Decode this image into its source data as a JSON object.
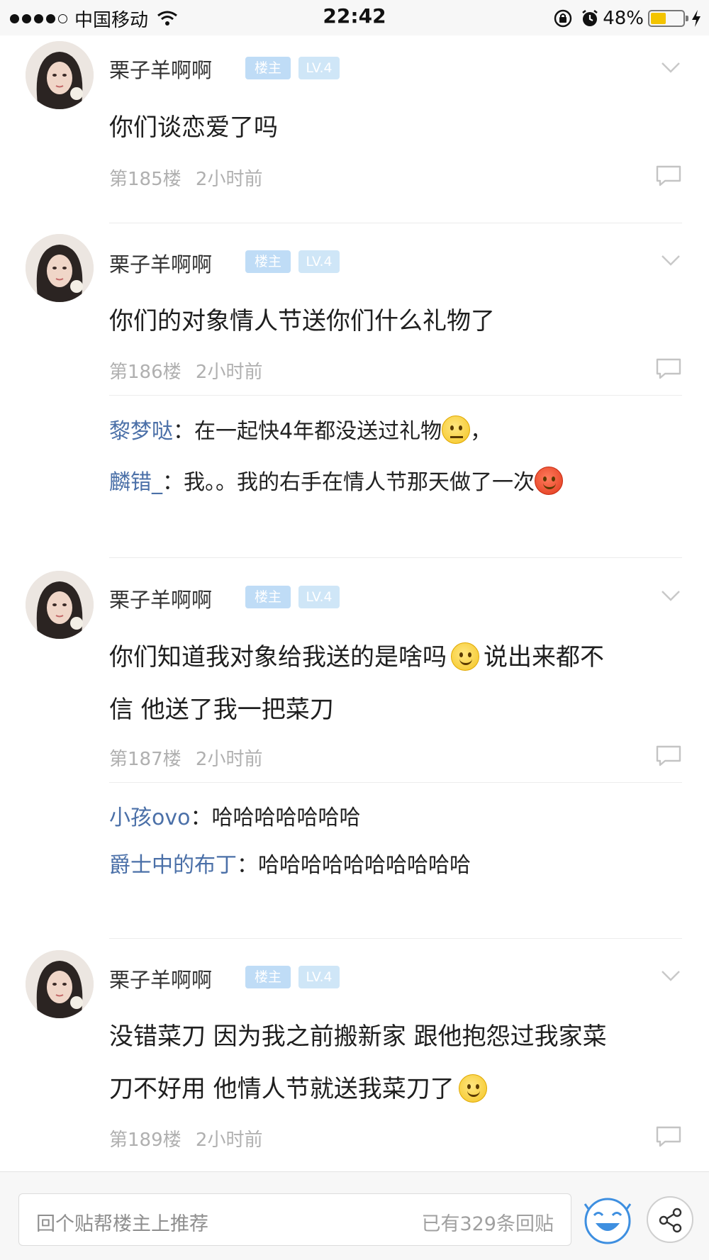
{
  "status_bar": {
    "carrier": "中国移动",
    "time": "22:42",
    "battery_percent": "48%",
    "battery_level": 0.48,
    "battery_color": "#f3c400"
  },
  "posts": [
    {
      "username": "栗子羊啊啊",
      "host_badge": "楼主",
      "level_badge": "LV.4",
      "content_lines": [
        "你们谈恋爱了吗"
      ],
      "floor": "第185楼",
      "time": "2小时前",
      "replies": []
    },
    {
      "username": "栗子羊啊啊",
      "host_badge": "楼主",
      "level_badge": "LV.4",
      "content_lines": [
        "你们的对象情人节送你们什么礼物了"
      ],
      "floor": "第186楼",
      "time": "2小时前",
      "replies": [
        {
          "user": "黎梦哒",
          "text_before": "在一起快4年都没送过礼物",
          "emoji": "sweat-face",
          "text_after": "，"
        },
        {
          "user": "麟错_",
          "text_before": "我。。我的右手在情人节那天做了一次",
          "emoji": "red-grin-face",
          "text_after": ""
        }
      ]
    },
    {
      "username": "栗子羊啊啊",
      "host_badge": "楼主",
      "level_badge": "LV.4",
      "content_lines": [
        "你们知道我对象给我送的是啥吗",
        "说出来都不",
        "信 他送了我一把菜刀"
      ],
      "floor": "第187楼",
      "time": "2小时前",
      "replies": [
        {
          "user": "小孩ovo",
          "text_before": "哈哈哈哈哈哈哈",
          "emoji": "",
          "text_after": ""
        },
        {
          "user": "爵士中的布丁",
          "text_before": "哈哈哈哈哈哈哈哈哈哈",
          "emoji": "",
          "text_after": ""
        }
      ]
    },
    {
      "username": "栗子羊啊啊",
      "host_badge": "楼主",
      "level_badge": "LV.4",
      "content_lines": [
        "没错菜刀 因为我之前搬新家 跟他抱怨过我家菜",
        "刀不好用 他情人节就送我菜刀了"
      ],
      "floor": "第189楼",
      "time": "2小时前",
      "replies": []
    }
  ],
  "bottom_bar": {
    "reply_placeholder": "回个贴帮楼主上推荐",
    "reply_count": "已有329条回贴",
    "face_icon": "laughing-face-icon",
    "share_icon": "share-icon"
  },
  "colors": {
    "reply_user": "#4b70a8",
    "host_badge": "#bfdcf6",
    "level_badge": "#cfe6f7",
    "meta_text": "#b0b0b0"
  }
}
